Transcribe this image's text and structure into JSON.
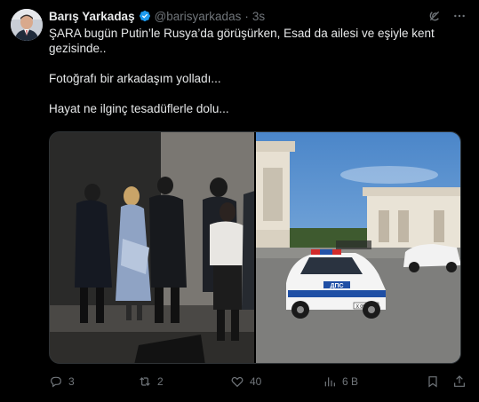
{
  "author": {
    "name": "Barış Yarkadaş",
    "handle": "@barisyarkadas",
    "separator": "·",
    "time": "3s"
  },
  "tweet": {
    "line1": "ŞARA bugün Putin’le Rusya’da görüşürken, Esad da ailesi ve eşiyle kent gezisinde..",
    "line2": "Fotoğrafı bir arkadaşım yolladı...",
    "line3": "Hayat ne ilginç tesadüflerle dolu..."
  },
  "media": {
    "right_plate_text": "ДПС",
    "right_plate_number": "Х 0987 77"
  },
  "actions": {
    "replies": "3",
    "reposts": "2",
    "likes": "40",
    "views": "6 B"
  },
  "colors": {
    "background": "#000000",
    "text": "#e7e9ea",
    "muted": "#71767b",
    "verified": "#1d9bf0",
    "border": "#2f3336"
  },
  "icons": {
    "verified": "verified-badge-icon",
    "grok": "grok-icon",
    "more": "more-icon",
    "reply": "reply-icon",
    "repost": "repost-icon",
    "like": "heart-icon",
    "views": "views-icon",
    "bookmark": "bookmark-icon",
    "share": "share-icon"
  }
}
